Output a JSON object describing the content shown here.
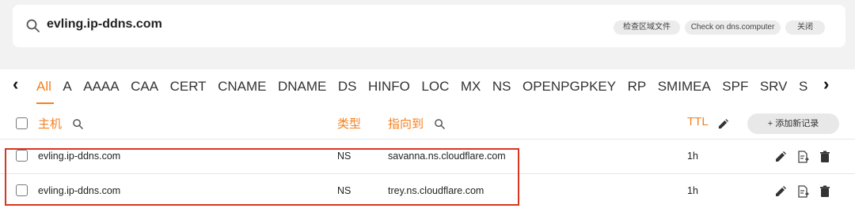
{
  "search": {
    "domain": "evling.ip-ddns.com",
    "buttons": [
      {
        "label": "检查区域文件"
      },
      {
        "label": "Check on dns.computer"
      },
      {
        "label": "关闭"
      }
    ]
  },
  "tabs": {
    "items": [
      "All",
      "A",
      "AAAA",
      "CAA",
      "CERT",
      "CNAME",
      "DNAME",
      "DS",
      "HINFO",
      "LOC",
      "MX",
      "NS",
      "OPENPGPKEY",
      "RP",
      "SMIMEA",
      "SPF",
      "SRV",
      "S"
    ],
    "active": "All"
  },
  "columns": {
    "host": "主机",
    "type": "类型",
    "target": "指向到",
    "ttl": "TTL",
    "add_label": "+ 添加新记录"
  },
  "records": [
    {
      "host": "evling.ip-ddns.com",
      "type": "NS",
      "target": "savanna.ns.cloudflare.com",
      "ttl": "1h"
    },
    {
      "host": "evling.ip-ddns.com",
      "type": "NS",
      "target": "trey.ns.cloudflare.com",
      "ttl": "1h"
    }
  ],
  "colors": {
    "accent": "#f38020",
    "highlight_border": "#d9351e"
  }
}
